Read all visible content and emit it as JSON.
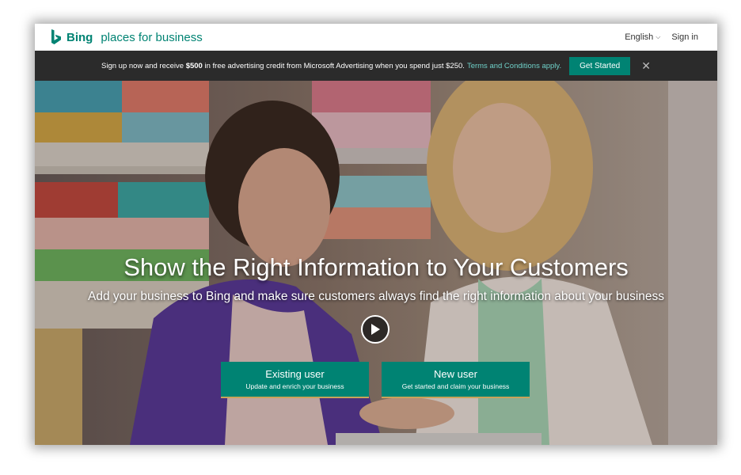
{
  "header": {
    "brand_name": "Bing",
    "brand_sub": "places for business",
    "language": "English",
    "sign_in": "Sign in"
  },
  "promo": {
    "text_before": "Sign up now and receive ",
    "amount": "$500",
    "text_after": " in free advertising credit from Microsoft Advertising when you spend just $250.",
    "link": "Terms and Conditions apply.",
    "button": "Get Started"
  },
  "hero": {
    "title": "Show the Right Information to Your Customers",
    "subtitle": "Add your business to Bing and make sure customers always find the right information about your business",
    "buttons": [
      {
        "title": "Existing user",
        "subtitle": "Update and enrich your business"
      },
      {
        "title": "New user",
        "subtitle": "Get started and claim your business"
      }
    ]
  },
  "colors": {
    "brand": "#008373",
    "promo_bg": "#2b2b2b",
    "link": "#6fd0c8",
    "cta_accent": "#c9a35a"
  },
  "icons": [
    "bing-logo-icon",
    "chevron-down-icon",
    "close-icon",
    "play-icon"
  ]
}
